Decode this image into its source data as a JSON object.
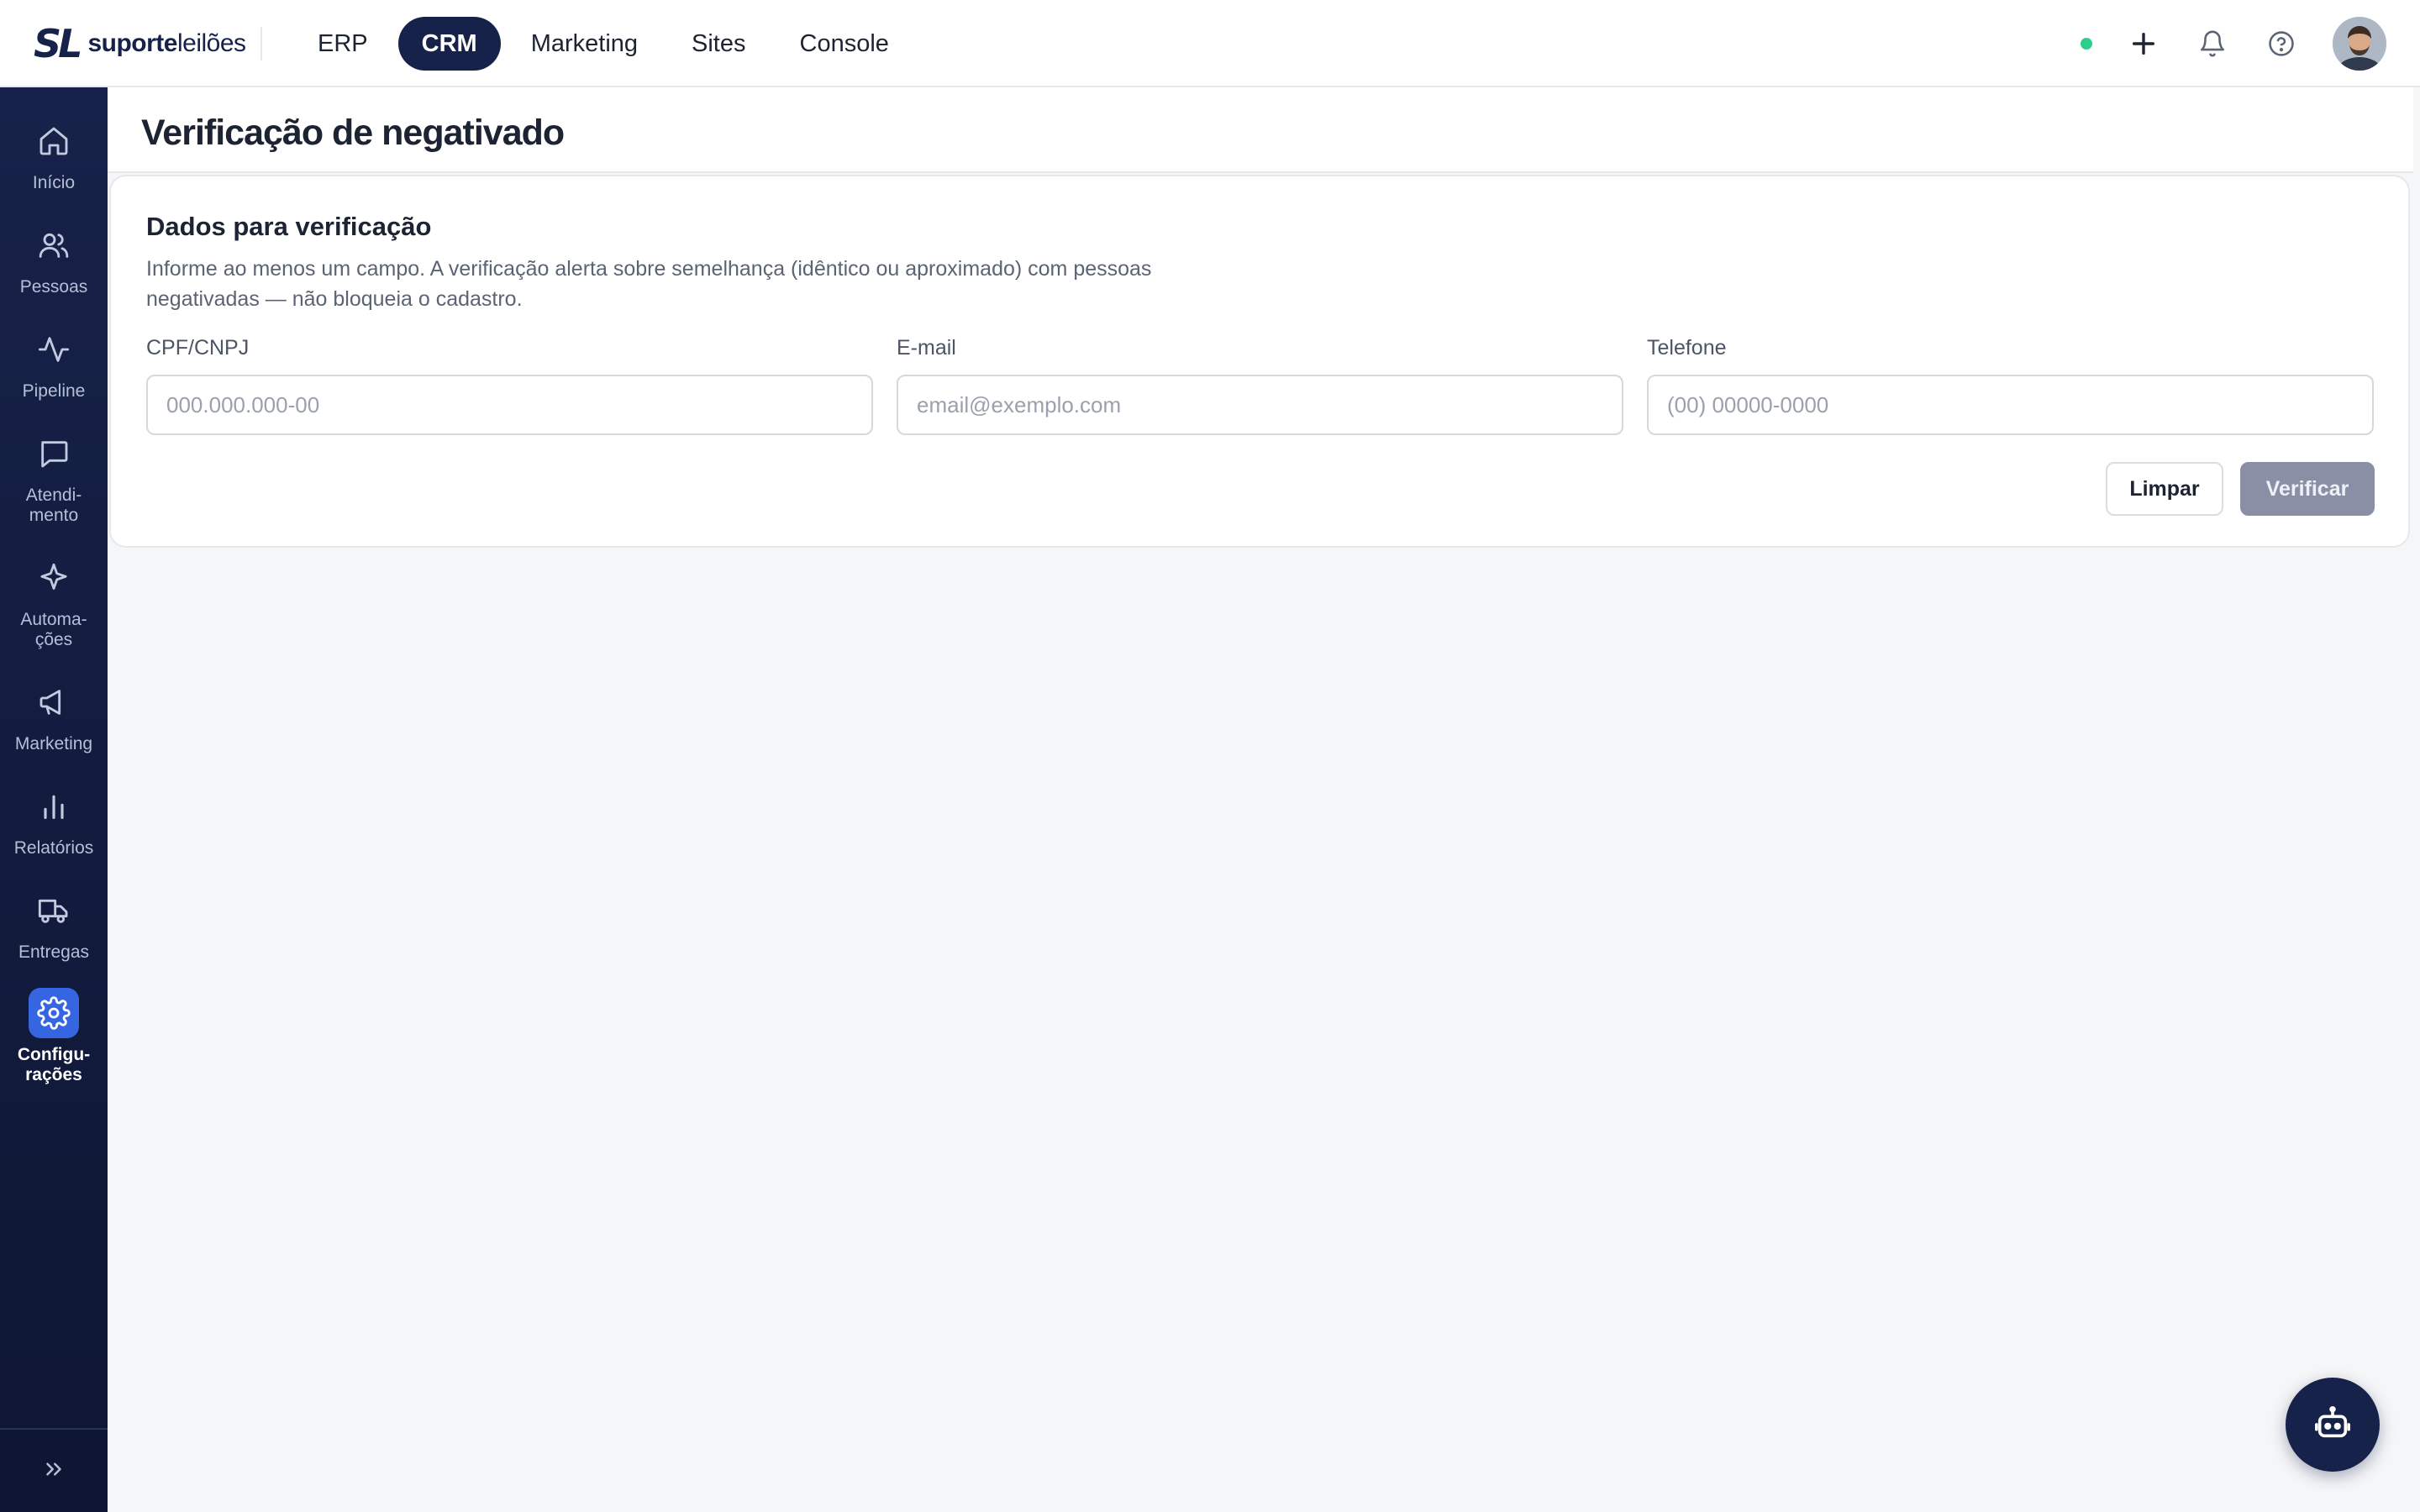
{
  "brand": {
    "mark": "SL",
    "name_bold": "suporte",
    "name_light": "leilões"
  },
  "topnav": {
    "items": [
      {
        "label": "ERP",
        "active": false
      },
      {
        "label": "CRM",
        "active": true
      },
      {
        "label": "Marketing",
        "active": false
      },
      {
        "label": "Sites",
        "active": false
      },
      {
        "label": "Console",
        "active": false
      }
    ]
  },
  "topbar_icons": [
    "status-dot",
    "plus-icon",
    "bell-icon",
    "help-icon",
    "avatar"
  ],
  "sidebar": {
    "items": [
      {
        "label": "Início",
        "icon": "home-icon",
        "active": false
      },
      {
        "label": "Pessoas",
        "icon": "users-icon",
        "active": false
      },
      {
        "label": "Pipeline",
        "icon": "activity-icon",
        "active": false
      },
      {
        "label": "Atendi-\nmento",
        "icon": "message-icon",
        "active": false
      },
      {
        "label": "Automa-\nções",
        "icon": "sparkle-icon",
        "active": false
      },
      {
        "label": "Marketing",
        "icon": "megaphone-icon",
        "active": false
      },
      {
        "label": "Relatórios",
        "icon": "bar-chart-icon",
        "active": false
      },
      {
        "label": "Entregas",
        "icon": "truck-icon",
        "active": false
      },
      {
        "label": "Configu-\nrações",
        "icon": "gear-icon",
        "active": true
      }
    ],
    "collapse_icon": "chevrons-right-icon"
  },
  "page": {
    "title": "Verificação de negativado"
  },
  "form": {
    "title": "Dados para verificação",
    "description": "Informe ao menos um campo. A verificação alerta sobre semelhança (idêntico ou aproximado) com pessoas negativadas — não bloqueia o cadastro.",
    "fields": {
      "cpf": {
        "label": "CPF/CNPJ",
        "placeholder": "000.000.000-00",
        "value": ""
      },
      "email": {
        "label": "E-mail",
        "placeholder": "email@exemplo.com",
        "value": ""
      },
      "phone": {
        "label": "Telefone",
        "placeholder": "(00) 00000-0000",
        "value": ""
      }
    },
    "clear_label": "Limpar",
    "verify_label": "Verificar"
  },
  "fab": {
    "icon": "bot-icon"
  },
  "colors": {
    "navy": "#17224a",
    "accent": "#3565e0",
    "status": "#2ccf8a",
    "disabled": "#8990a6"
  }
}
